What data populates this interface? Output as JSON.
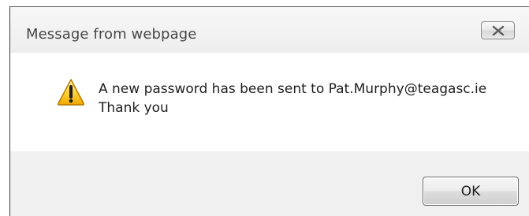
{
  "dialog": {
    "title": "Message from webpage",
    "message_line1": "A new password has been sent to Pat.Murphy@teagasc.ie",
    "message_line2": "Thank you",
    "ok_label": "OK",
    "icon": "warning-icon",
    "close_icon": "close-icon"
  }
}
